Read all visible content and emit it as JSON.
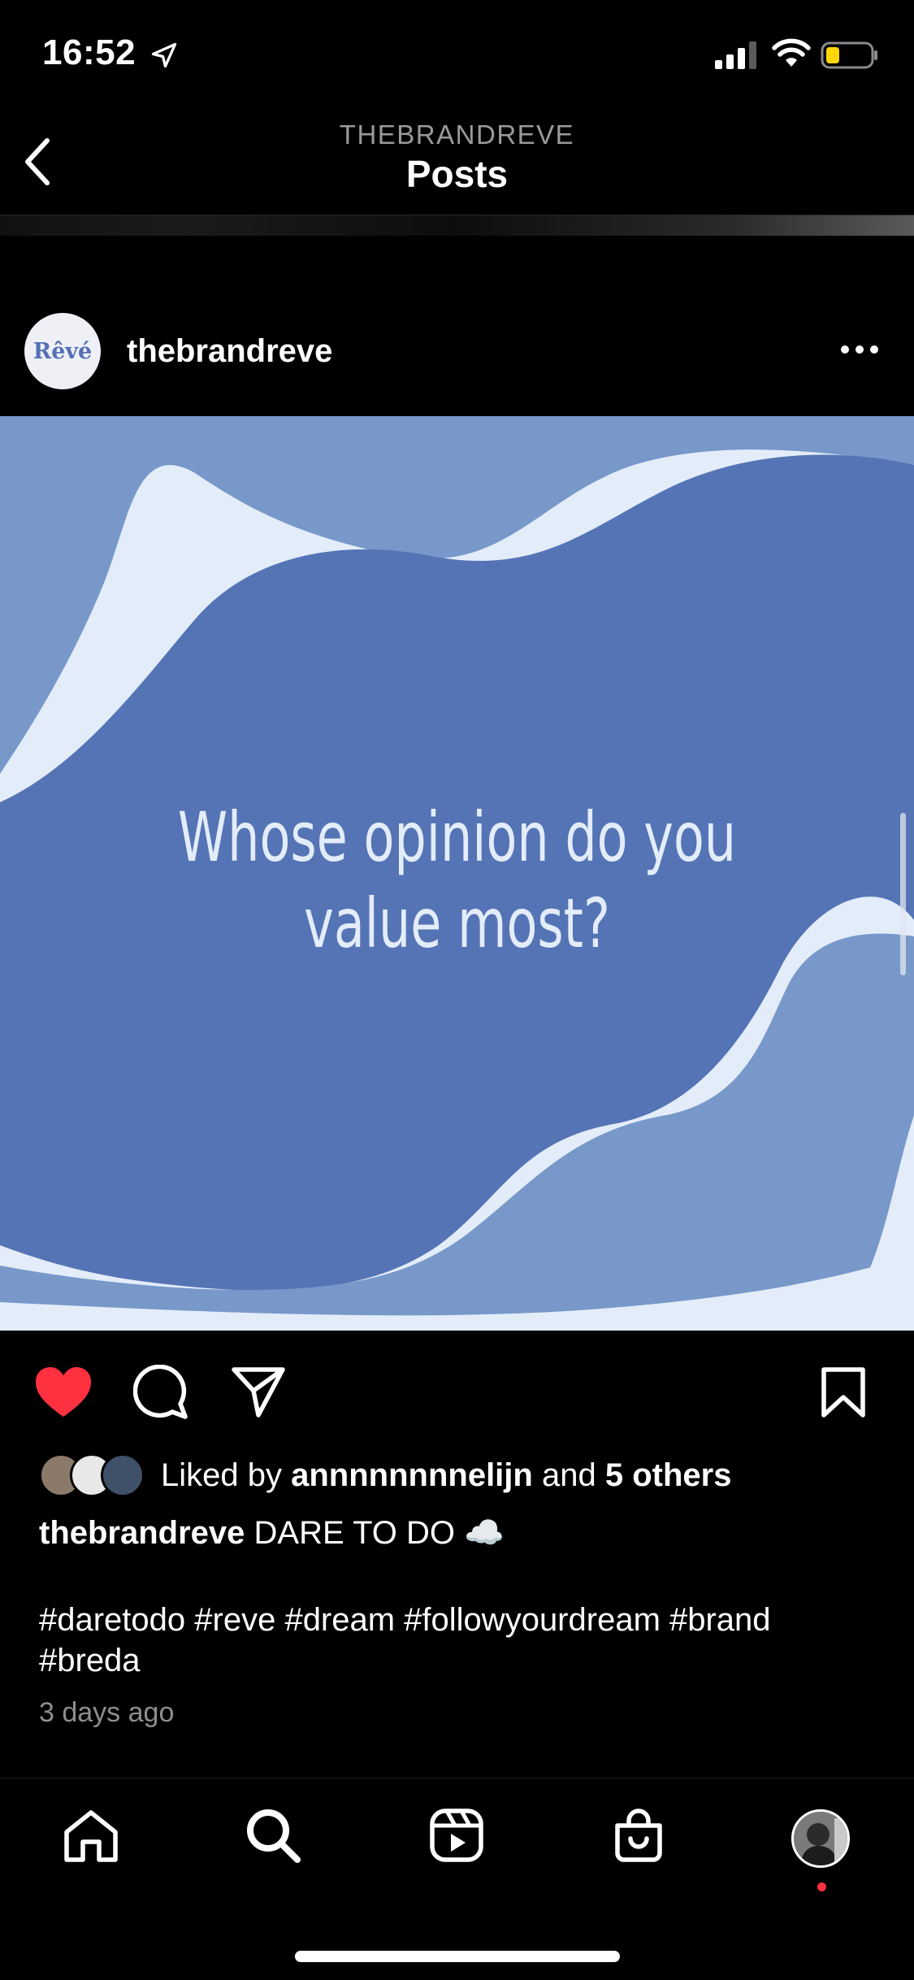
{
  "status_bar": {
    "time": "16:52",
    "icons": [
      "location-arrow-icon",
      "cellular-signal-icon",
      "wifi-icon",
      "battery-icon"
    ],
    "battery_color": "#ffd60a"
  },
  "nav": {
    "subtitle": "THEBRANDREVE",
    "title": "Posts",
    "back_icon": "chevron-left-icon"
  },
  "post": {
    "avatar_text": "Rêvé",
    "username": "thebrandreve",
    "more_icon": "ellipsis-icon",
    "image": {
      "quote_line1": "Whose opinion do you",
      "quote_line2": "value most?",
      "colors": {
        "dark_blue": "#5574b5",
        "mid_blue": "#7798c9",
        "light": "#e3ecf9"
      }
    },
    "actions": {
      "like_icon": "heart-filled-icon",
      "comment_icon": "comment-icon",
      "share_icon": "send-icon",
      "save_icon": "bookmark-icon",
      "like_color": "#ff3040"
    },
    "likes": {
      "prefix": "Liked by",
      "user": "annnnnnnnelijn",
      "conjunction": "and",
      "others": "5 others"
    },
    "caption": {
      "username": "thebrandreve",
      "text": "DARE TO DO",
      "emoji": "☁️"
    },
    "hashtags_line1": "#daretodo #reve #dream #followyourdream #brand",
    "hashtags_line2": "#breda",
    "time_ago": "3 days ago"
  },
  "tab_bar": {
    "tabs": [
      "home-icon",
      "search-icon",
      "reels-icon",
      "shop-icon",
      "profile-avatar"
    ],
    "notification_color": "#ff3040"
  }
}
